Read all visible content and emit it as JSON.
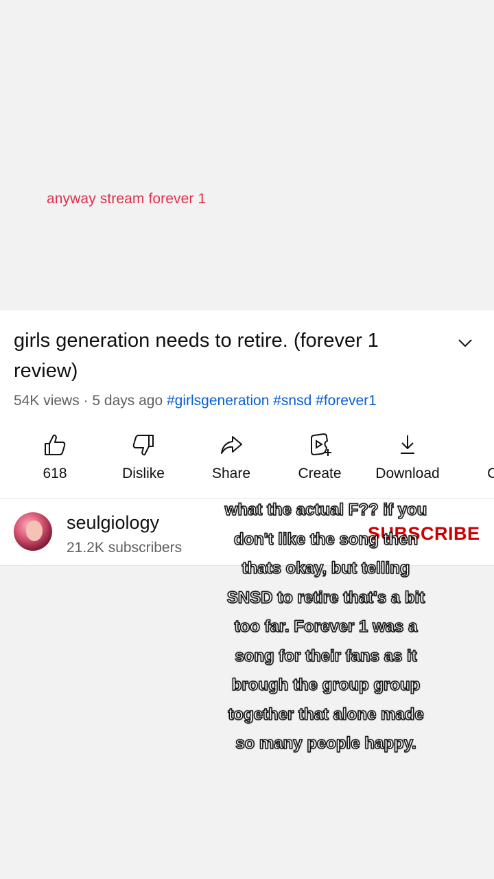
{
  "top_caption": "anyway stream forever 1",
  "video": {
    "title": "girls generation needs to retire. (forever 1 review)",
    "views": "54K views",
    "age": "5 days ago",
    "hashtags": "#girlsgeneration #snsd #forever1"
  },
  "actions": [
    {
      "label": "618",
      "icon": "thumbs-up-icon"
    },
    {
      "label": "Dislike",
      "icon": "thumbs-down-icon"
    },
    {
      "label": "Share",
      "icon": "share-icon"
    },
    {
      "label": "Create",
      "icon": "create-icon"
    },
    {
      "label": "Download",
      "icon": "download-icon"
    },
    {
      "label": "Cl",
      "icon": "clip-icon"
    }
  ],
  "channel": {
    "name": "seulgiology",
    "subscribers": "21.2K subscribers",
    "subscribe_label": "SUBSCRIBE"
  },
  "overlay_lines": [
    "what the actual F?? if you",
    "don't like the song then",
    "thats okay, but telling",
    "SNSD to retire that's a bit",
    "too far. Forever 1 was a",
    "song for their fans as it",
    "brough the group group",
    "together that alone made",
    "so many people happy."
  ],
  "colors": {
    "caption": "#e0304a",
    "hashtag": "#065fd4",
    "subscribe": "#cc0000"
  }
}
